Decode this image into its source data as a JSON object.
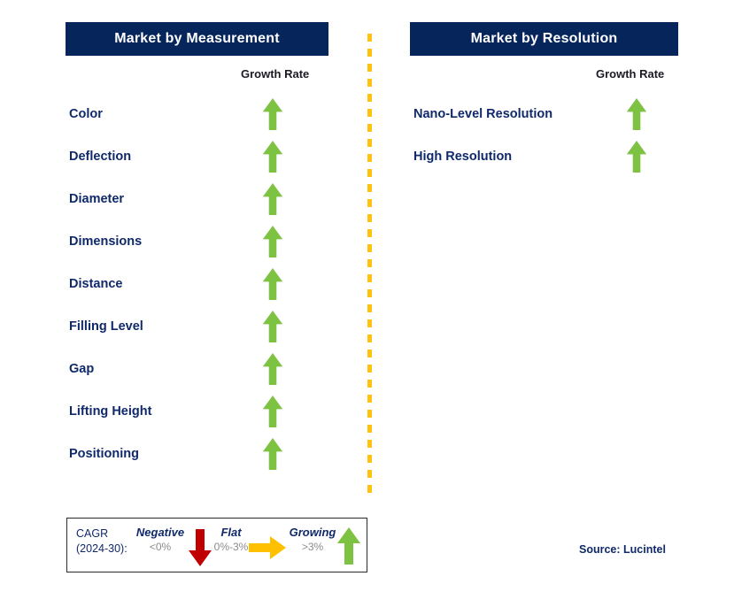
{
  "panels": [
    {
      "id": "measurement",
      "title": "Market by Measurement",
      "growth_rate_label": "Growth Rate",
      "rows": [
        {
          "label": "Color",
          "trend": "growing"
        },
        {
          "label": "Deflection",
          "trend": "growing"
        },
        {
          "label": "Diameter",
          "trend": "growing"
        },
        {
          "label": "Dimensions",
          "trend": "growing"
        },
        {
          "label": "Distance",
          "trend": "growing"
        },
        {
          "label": "Filling Level",
          "trend": "growing"
        },
        {
          "label": "Gap",
          "trend": "growing"
        },
        {
          "label": "Lifting Height",
          "trend": "growing"
        },
        {
          "label": "Positioning",
          "trend": "growing"
        }
      ]
    },
    {
      "id": "resolution",
      "title": "Market by Resolution",
      "growth_rate_label": "Growth Rate",
      "rows": [
        {
          "label": "Nano-Level Resolution",
          "trend": "growing"
        },
        {
          "label": "High Resolution",
          "trend": "growing"
        }
      ]
    }
  ],
  "legend": {
    "cagr_line1": "CAGR",
    "cagr_line2": "(2024-30):",
    "items": [
      {
        "word": "Negative",
        "range": "<0%",
        "icon": "arrow-down-icon",
        "color": "#C00000"
      },
      {
        "word": "Flat",
        "range": "0%-3%",
        "icon": "arrow-right-icon",
        "color": "#FFC000"
      },
      {
        "word": "Growing",
        "range": ">3%",
        "icon": "arrow-up-icon",
        "color": "#7DC242"
      }
    ]
  },
  "source": "Source: Lucintel",
  "colors": {
    "header_navy": "#06255B",
    "label_navy": "#10296B",
    "growing_green": "#7DC242",
    "negative_red": "#C00000",
    "flat_amber": "#FFC000",
    "divider_amber": "#FFC20E"
  },
  "divider": {
    "dash_count": 31
  }
}
